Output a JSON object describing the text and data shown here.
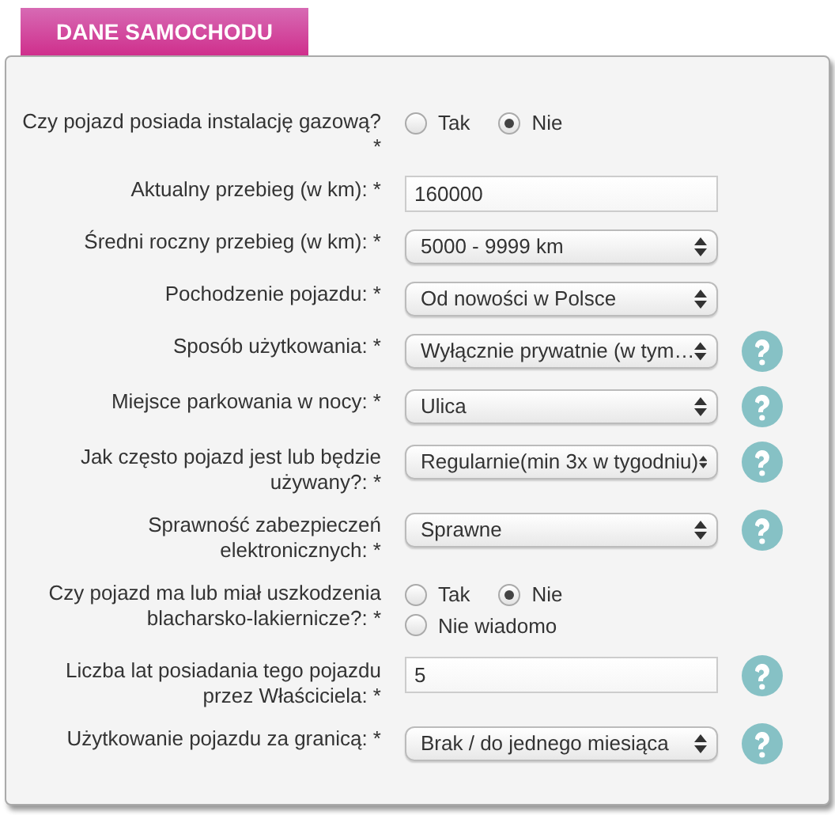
{
  "section_tab": "DANE SAMOCHODU",
  "fields": [
    {
      "kind": "radio",
      "label": "Czy pojazd posiada instalację gazową? *",
      "help": false,
      "options": [
        {
          "label": "Tak",
          "selected": false
        },
        {
          "label": "Nie",
          "selected": true
        }
      ]
    },
    {
      "kind": "text",
      "label": "Aktualny przebieg (w km): *",
      "value": "160000",
      "help": false
    },
    {
      "kind": "select",
      "label": "Średni roczny przebieg (w km): *",
      "value": "5000 - 9999 km",
      "help": false
    },
    {
      "kind": "select",
      "label": "Pochodzenie pojazdu: *",
      "value": "Od nowości w Polsce",
      "help": false
    },
    {
      "kind": "select",
      "label": "Sposób użytkowania: *",
      "value": "Wyłącznie prywatnie (w tym…",
      "help": true
    },
    {
      "kind": "select",
      "label": "Miejsce parkowania w nocy: *",
      "value": "Ulica",
      "help": true
    },
    {
      "kind": "select",
      "label": "Jak często pojazd jest lub będzie używany?: *",
      "value": "Regularnie(min 3x w tygodniu)",
      "help": true
    },
    {
      "kind": "select",
      "label": "Sprawność zabezpieczeń elektronicznych: *",
      "value": "Sprawne",
      "help": true
    },
    {
      "kind": "radio",
      "label": "Czy pojazd ma lub miał uszkodzenia blacharsko-lakiernicze?: *",
      "help": false,
      "options": [
        {
          "label": "Tak",
          "selected": false
        },
        {
          "label": "Nie",
          "selected": true
        },
        {
          "label": "Nie wiadomo",
          "selected": false
        }
      ]
    },
    {
      "kind": "text",
      "label": "Liczba lat posiadania tego pojazdu przez Właściciela: *",
      "value": "5",
      "help": true
    },
    {
      "kind": "select",
      "label": "Użytkowanie pojazdu za granicą: *",
      "value": "Brak / do jednego miesiąca",
      "help": true
    }
  ]
}
